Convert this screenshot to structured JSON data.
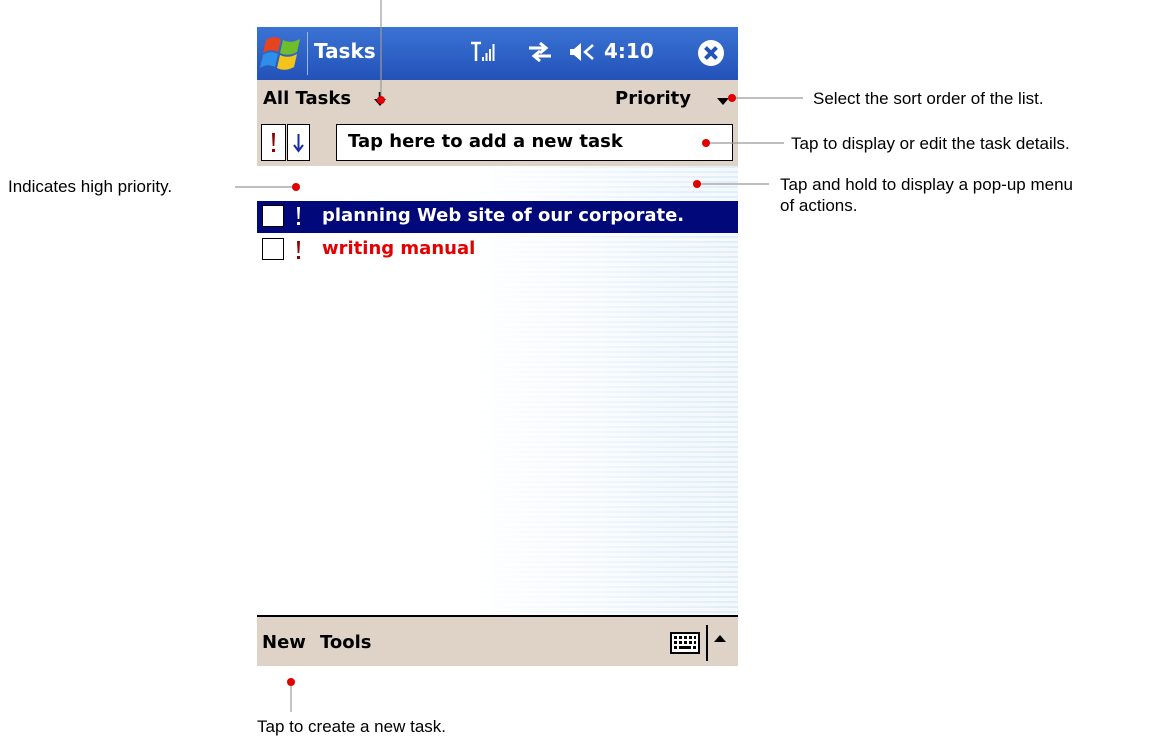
{
  "titlebar": {
    "title": "Tasks",
    "time": "4:10"
  },
  "filter": {
    "label": "All Tasks",
    "sort_label": "Priority"
  },
  "new_task": {
    "placeholder": "Tap here to add a new task"
  },
  "tasks": [
    {
      "text": "planning Web site of our corporate.",
      "priority": "high",
      "selected": true
    },
    {
      "text": "writing manual",
      "priority": "high",
      "selected": false
    }
  ],
  "menubar": {
    "new_label": "New",
    "tools_label": "Tools"
  },
  "callouts": {
    "sort": "Select the sort order of the list.",
    "details": "Tap to display or edit the task details.",
    "popup_line1": "Tap and hold to display a pop-up menu",
    "popup_line2": "of actions.",
    "priority": "Indicates high priority.",
    "new_task": "Tap to create a new task."
  },
  "colors": {
    "titlebar": "#2352b8",
    "selection": "#00087a",
    "high_priority_text": "#e40000",
    "chrome": "#ded3c6",
    "callout_dot": "#e00000"
  },
  "icons": [
    "windows-logo-icon",
    "signal-icon",
    "sync-icon",
    "volume-icon",
    "close-icon",
    "dropdown-arrow-icon",
    "priority-icon",
    "sort-order-icon",
    "keyboard-icon",
    "up-arrow-icon"
  ]
}
